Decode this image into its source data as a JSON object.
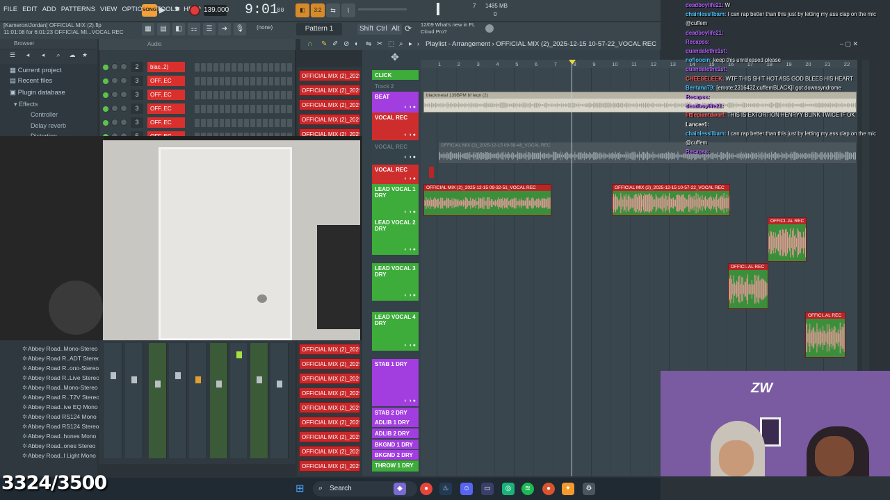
{
  "menu": [
    "FILE",
    "EDIT",
    "ADD",
    "PATTERNS",
    "VIEW",
    "OPTIONS",
    "TOOLS",
    "HELP"
  ],
  "transport": {
    "song_label": "SONG",
    "tempo": "139.000",
    "time": "9:01",
    "time_ms": "00",
    "cpu_number": "7",
    "memory": "1485 MB",
    "memory_sub": "0"
  },
  "project": {
    "line1": "[Kameron/Jordan] OFFICIAL MIX (2).flp",
    "line2": "11:01:08 for 6:01:23     OFFICIAL MI...VOCAL REC"
  },
  "toolbar": {
    "snap": "(none)",
    "pattern": "Pattern 1",
    "keys": [
      "Shift",
      "Ctrl",
      "Alt"
    ],
    "news_line1": "12/09  What's new in FL",
    "news_line2": "Cloud Pro?"
  },
  "browser": {
    "header": "Browser",
    "items": [
      "Current project",
      "Recent files",
      "Plugin database"
    ],
    "sub_items": [
      "Effects",
      "Controller",
      "Delay reverb",
      "Distortion"
    ],
    "plugins": [
      "Abbey Road..Mono-Stereo",
      "Abbey Road R..ADT Stereo",
      "Abbey Road R..ono-Stereo",
      "Abbey Road R..Live Stereo",
      "Abbey Road..Mono-Stereo",
      "Abbey Road R..T2V Stereo",
      "Abbey Road..ive EQ Mono",
      "Abbey Road RS124 Mono",
      "Abbey Road RS124 Stereo",
      "Abbey Road..hones Mono",
      "Abbey Road..ones Stereo",
      "Abbey Road..l Light Mono"
    ]
  },
  "rack": {
    "header_tab": "Audio",
    "rows": [
      {
        "num": "2",
        "name": "blac..2)"
      },
      {
        "num": "3",
        "name": "OFF..EC"
      },
      {
        "num": "3",
        "name": "OFF..EC"
      },
      {
        "num": "3",
        "name": "OFF..EC"
      },
      {
        "num": "3",
        "name": "OFF..EC"
      },
      {
        "num": "5",
        "name": "OFF..EC"
      }
    ]
  },
  "instruments": {
    "label": "OFFICIAL MIX (2)_2025-1...",
    "count_top": 5,
    "count_bottom": 9
  },
  "playlist": {
    "title": "Playlist - Arrangement",
    "arrow": "›",
    "path": "OFFICIAL MIX (2)_2025-12-15 10-57-22_VOCAL REC",
    "ruler": [
      "1",
      "2",
      "3",
      "4",
      "5",
      "6",
      "7",
      "8",
      "9",
      "10",
      "11",
      "12",
      "13",
      "14",
      "15",
      "16",
      "17",
      "18",
      "19",
      "20",
      "21",
      "22",
      "23"
    ],
    "tracks": [
      {
        "name": "CLICK",
        "color": "green"
      },
      {
        "name": "Track 2",
        "color": "dim"
      },
      {
        "name": "BEAT",
        "color": "purple"
      },
      {
        "name": "VOCAL REC",
        "color": "red"
      },
      {
        "name": "VOCAL REC",
        "color": "dim"
      },
      {
        "name": "VOCAL REC",
        "color": "red"
      },
      {
        "name": "LEAD VOCAL 1 DRY",
        "color": "green"
      },
      {
        "name": "LEAD VOCAL 2 DRY",
        "color": "green"
      },
      {
        "name": "LEAD VOCAL 3 DRY",
        "color": "green"
      },
      {
        "name": "LEAD VOCAL 4 DRY",
        "color": "green"
      },
      {
        "name": "STAB 1 DRY",
        "color": "purple"
      },
      {
        "name": "STAB 2 DRY",
        "color": "purple"
      },
      {
        "name": "ADLIB 1 DRY",
        "color": "purple"
      },
      {
        "name": "ADLIB 2 DRY",
        "color": "purple"
      },
      {
        "name": "BKGND 1 DRY",
        "color": "purple"
      },
      {
        "name": "BKGND 2 DRY",
        "color": "purple"
      },
      {
        "name": "THROW 1 DRY",
        "color": "green"
      }
    ],
    "clips": {
      "beat": "blackmetal 139BPM bf leqn (2)",
      "vocal_rec_dim": "OFFICIAL MIX (2)_2025-12-15 09-58-48_VOCAL REC",
      "lead1_a": "OFFICIAL MIX (2)_2025-12-15 09-32-51_VOCAL REC",
      "lead1_b": "OFFICIAL MIX (2)_2025-12-15 10-57-22_VOCAL REC",
      "short": "OFFICI..AL REC"
    }
  },
  "chat": [
    {
      "user": "deadboylife21:",
      "msg": "W",
      "color": "#b25dff"
    },
    {
      "user": "chainlessllbam:",
      "msg": "I can rap better than this just by letting my ass clap on the mic",
      "color": "#4ec2ff"
    },
    {
      "user": "",
      "msg": "@cuffem",
      "color": "#ffffff"
    },
    {
      "user": "deadboylife21:",
      "msg": "",
      "color": "#b25dff"
    },
    {
      "user": "Recapss:",
      "msg": "",
      "color": "#b25dff"
    },
    {
      "user": "quandalethe1st:",
      "msg": "",
      "color": "#b25dff"
    },
    {
      "user": "nofloocin:",
      "msg": "keep this unreleased please",
      "color": "#4ec2ff"
    },
    {
      "user": "quandalethe1st:",
      "msg": "",
      "color": "#b25dff"
    },
    {
      "user": "CHEESELEEK:",
      "msg": "WTF THIS SHIT HOT ASS GOD BLEES HIS HEART",
      "color": "#ff5a5a"
    },
    {
      "user": "Bentana79:",
      "msg": "[emote:2316432:cuffemBLACK]I got downsyndrome",
      "color": "#4ec2ff"
    },
    {
      "user": "Recapss:",
      "msg": "",
      "color": "#b25dff"
    },
    {
      "user": "deadboylife21:",
      "msg": "",
      "color": "#b25dff"
    },
    {
      "user": "littlegiantdwarf:",
      "msg": "THIS IS EXTORTION HENRYY BLINK TWICE IF OK",
      "color": "#ff5a5a"
    },
    {
      "user": "Lancee1:",
      "msg": "",
      "color": "#ffffff"
    },
    {
      "user": "chainlessllbam:",
      "msg": "I can rap better than this just by letting my ass clap on the mic",
      "color": "#4ec2ff"
    },
    {
      "user": "",
      "msg": "@cuffem",
      "color": "#ffffff"
    },
    {
      "user": "Recapss:",
      "msg": "",
      "color": "#b25dff"
    }
  ],
  "overlay": {
    "counter": "3324/3500"
  },
  "taskbar": {
    "search": "Search"
  },
  "colors": {
    "fl_bg": "#2b3338",
    "clip_red": "#ce2d2e",
    "track_green": "#3dac3a",
    "track_purple": "#a23de0",
    "waveform_pink": "#f19aa0",
    "song_orange": "#f2a03a"
  },
  "icons": [
    "play-icon",
    "stop-icon",
    "record-icon",
    "search-icon",
    "windows-start-icon",
    "chrome-icon",
    "steam-icon",
    "discord-icon",
    "spotify-icon",
    "fl-studio-icon",
    "settings-icon"
  ]
}
